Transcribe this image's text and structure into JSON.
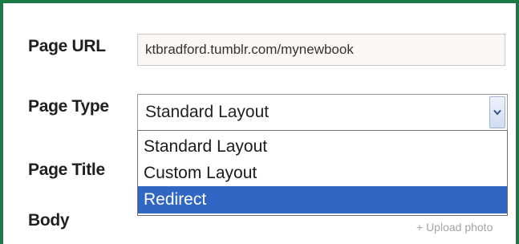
{
  "form": {
    "page_url_label": "Page URL",
    "page_url_value": "ktbradford.tumblr.com/mynewbook",
    "page_type_label": "Page Type",
    "page_type_selected": "Standard Layout",
    "page_type_options": [
      "Standard Layout",
      "Custom Layout",
      "Redirect"
    ],
    "highlighted_option": "Redirect",
    "page_title_label": "Page Title",
    "body_label": "Body",
    "upload_photo_link": "+ Upload photo"
  },
  "colors": {
    "frame_border": "#1a7a46",
    "selection_highlight": "#3166c4"
  },
  "icons": {
    "select_arrow": "chevron-down-icon"
  }
}
